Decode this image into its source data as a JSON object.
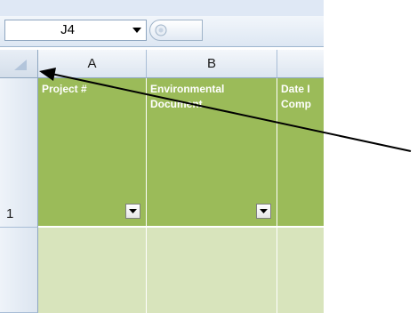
{
  "name_box": {
    "value": "J4"
  },
  "columns": [
    {
      "letter": "A"
    },
    {
      "letter": "B"
    },
    {
      "letter": ""
    }
  ],
  "rows": [
    {
      "number": "1"
    },
    {
      "number": ""
    }
  ],
  "header_cells": [
    {
      "line1": "Project #",
      "line2": ""
    },
    {
      "line1": "Environmental",
      "line2": "Document"
    },
    {
      "line1": "Date I",
      "line2": "Comp"
    }
  ],
  "colors": {
    "header_fill": "#9bbb59",
    "data_fill": "#d8e4bc"
  },
  "icons": {
    "name_box_dropdown": "chevron-down-icon",
    "formula_button": "fx-icon",
    "select_all": "select-all-triangle-icon",
    "filter": "filter-dropdown-icon",
    "annotation": "pointer-arrow-icon"
  }
}
